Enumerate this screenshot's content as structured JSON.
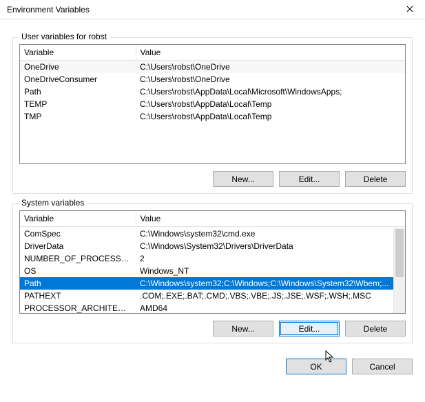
{
  "window": {
    "title": "Environment Variables",
    "close_icon": "×"
  },
  "user_group": {
    "label": "User variables for robst",
    "columns": {
      "var": "Variable",
      "val": "Value"
    },
    "rows": [
      {
        "var": "OneDrive",
        "val": "C:\\Users\\robst\\OneDrive"
      },
      {
        "var": "OneDriveConsumer",
        "val": "C:\\Users\\robst\\OneDrive"
      },
      {
        "var": "Path",
        "val": "C:\\Users\\robst\\AppData\\Local\\Microsoft\\WindowsApps;"
      },
      {
        "var": "TEMP",
        "val": "C:\\Users\\robst\\AppData\\Local\\Temp"
      },
      {
        "var": "TMP",
        "val": "C:\\Users\\robst\\AppData\\Local\\Temp"
      }
    ],
    "buttons": {
      "new": "New...",
      "edit": "Edit...",
      "delete": "Delete"
    }
  },
  "sys_group": {
    "label": "System variables",
    "columns": {
      "var": "Variable",
      "val": "Value"
    },
    "rows": [
      {
        "var": "ComSpec",
        "val": "C:\\Windows\\system32\\cmd.exe"
      },
      {
        "var": "DriverData",
        "val": "C:\\Windows\\System32\\Drivers\\DriverData"
      },
      {
        "var": "NUMBER_OF_PROCESSORS",
        "val": "2"
      },
      {
        "var": "OS",
        "val": "Windows_NT"
      },
      {
        "var": "Path",
        "val": "C:\\Windows\\system32;C:\\Windows;C:\\Windows\\System32\\Wbem;...",
        "selected": true
      },
      {
        "var": "PATHEXT",
        "val": ".COM;.EXE;.BAT;.CMD;.VBS;.VBE;.JS;.JSE;.WSF;.WSH;.MSC"
      },
      {
        "var": "PROCESSOR_ARCHITECTURE",
        "val": "AMD64"
      }
    ],
    "buttons": {
      "new": "New...",
      "edit": "Edit...",
      "delete": "Delete"
    }
  },
  "footer": {
    "ok": "OK",
    "cancel": "Cancel"
  }
}
